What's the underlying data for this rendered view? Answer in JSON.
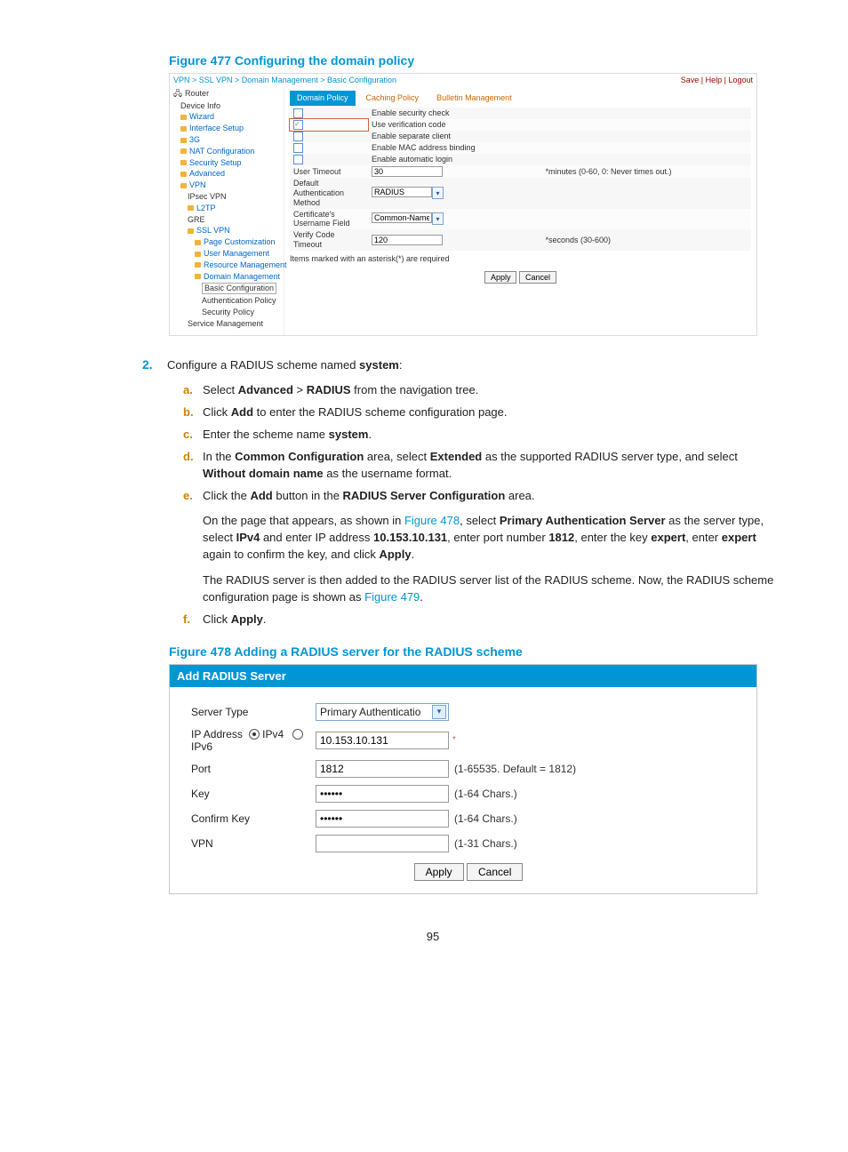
{
  "figure477": {
    "title": "Figure 477 Configuring the domain policy",
    "breadcrumb": "VPN > SSL VPN > Domain Management > Basic Configuration",
    "header_links": "Save | Help | Logout",
    "root": "Router",
    "nav": {
      "device_info": "Device Info",
      "wizard": "Wizard",
      "interface_setup": "Interface Setup",
      "three_g": "3G",
      "nat": "NAT Configuration",
      "security": "Security Setup",
      "advanced": "Advanced",
      "vpn": "VPN",
      "ipsec": "IPsec VPN",
      "l2tp": "L2TP",
      "gre": "GRE",
      "sslvpn": "SSL VPN",
      "page_cust": "Page Customization",
      "user_mgmt": "User Management",
      "res_mgmt": "Resource Management",
      "domain_mgmt": "Domain Management",
      "basic_conf": "Basic Configuration",
      "auth_policy": "Authentication Policy",
      "sec_policy": "Security Policy",
      "service_mgmt": "Service Management"
    },
    "tabs": {
      "domain_policy": "Domain Policy",
      "caching_policy": "Caching Policy",
      "bulletin": "Bulletin Management"
    },
    "options": {
      "enable_sec": "Enable security check",
      "use_verif": "Use verification code",
      "enable_sep": "Enable separate client",
      "enable_mac": "Enable MAC address binding",
      "enable_auto": "Enable automatic login"
    },
    "fields": {
      "user_timeout": "User Timeout",
      "user_timeout_val": "30",
      "user_timeout_hint": "*minutes (0-60, 0: Never times out.)",
      "def_auth": "Default Authentication Method",
      "def_auth_val": "RADIUS",
      "cert_user": "Certificate's Username Field",
      "cert_user_val": "Common-Name",
      "verify_timeout": "Verify Code Timeout",
      "verify_timeout_val": "120",
      "verify_timeout_hint": "*seconds (30-600)",
      "req_note": "Items marked with an asterisk(*) are required",
      "apply": "Apply",
      "cancel": "Cancel"
    }
  },
  "step2": {
    "number": "2.",
    "intro_pre": "Configure a RADIUS scheme named ",
    "intro_bold": "system",
    "intro_post": ":",
    "a": {
      "letter": "a.",
      "t1": "Select ",
      "b1": "Advanced",
      "t2": " > ",
      "b2": "RADIUS",
      "t3": " from the navigation tree."
    },
    "b": {
      "letter": "b.",
      "t1": "Click ",
      "b1": "Add",
      "t2": " to enter the RADIUS scheme configuration page."
    },
    "c": {
      "letter": "c.",
      "t1": "Enter the scheme name ",
      "b1": "system",
      "t2": "."
    },
    "d": {
      "letter": "d.",
      "t1": "In the ",
      "b1": "Common Configuration",
      "t2": " area, select ",
      "b2": "Extended",
      "t3": " as the supported RADIUS server type, and select ",
      "b3": "Without domain name",
      "t4": " as the username format."
    },
    "e": {
      "letter": "e.",
      "t1": "Click the ",
      "b1": "Add",
      "t2": " button in the ",
      "b2": "RADIUS Server Configuration",
      "t3": " area.",
      "p2_t1": "On the page that appears, as shown in ",
      "p2_link1": "Figure 478",
      "p2_t2": ", select ",
      "p2_b1": "Primary Authentication Server",
      "p2_t3": " as the server type, select ",
      "p2_b2": "IPv4",
      "p2_t4": " and enter IP address ",
      "p2_b3": "10.153.10.131",
      "p2_t5": ", enter port number ",
      "p2_b4": "1812",
      "p2_t6": ", enter the key ",
      "p2_b5": "expert",
      "p2_t7": ", enter ",
      "p2_b6": "expert",
      "p2_t8": " again to confirm the key, and click ",
      "p2_b7": "Apply",
      "p2_t9": ".",
      "p3_t1": "The RADIUS server is then added to the RADIUS server list of the RADIUS scheme. Now, the RADIUS scheme configuration page is shown as ",
      "p3_link": "Figure 479",
      "p3_t2": "."
    },
    "f": {
      "letter": "f.",
      "t1": "Click ",
      "b1": "Apply",
      "t2": "."
    }
  },
  "figure478": {
    "title": "Figure 478 Adding a RADIUS server for the RADIUS scheme",
    "header": "Add RADIUS Server",
    "server_type_label": "Server Type",
    "server_type_value": "Primary Authenticatio",
    "ip_label": "IP Address",
    "ipv4": "IPv4",
    "ipv6": "IPv6",
    "ip_value": "10.153.10.131",
    "port_label": "Port",
    "port_value": "1812",
    "port_hint": "(1-65535. Default = 1812)",
    "key_label": "Key",
    "key_value": "••••••",
    "key_hint": "(1-64 Chars.)",
    "confirm_label": "Confirm Key",
    "confirm_value": "••••••",
    "confirm_hint": "(1-64 Chars.)",
    "vpn_label": "VPN",
    "vpn_value": "",
    "vpn_hint": "(1-31 Chars.)",
    "apply": "Apply",
    "cancel": "Cancel"
  },
  "page_number": "95"
}
